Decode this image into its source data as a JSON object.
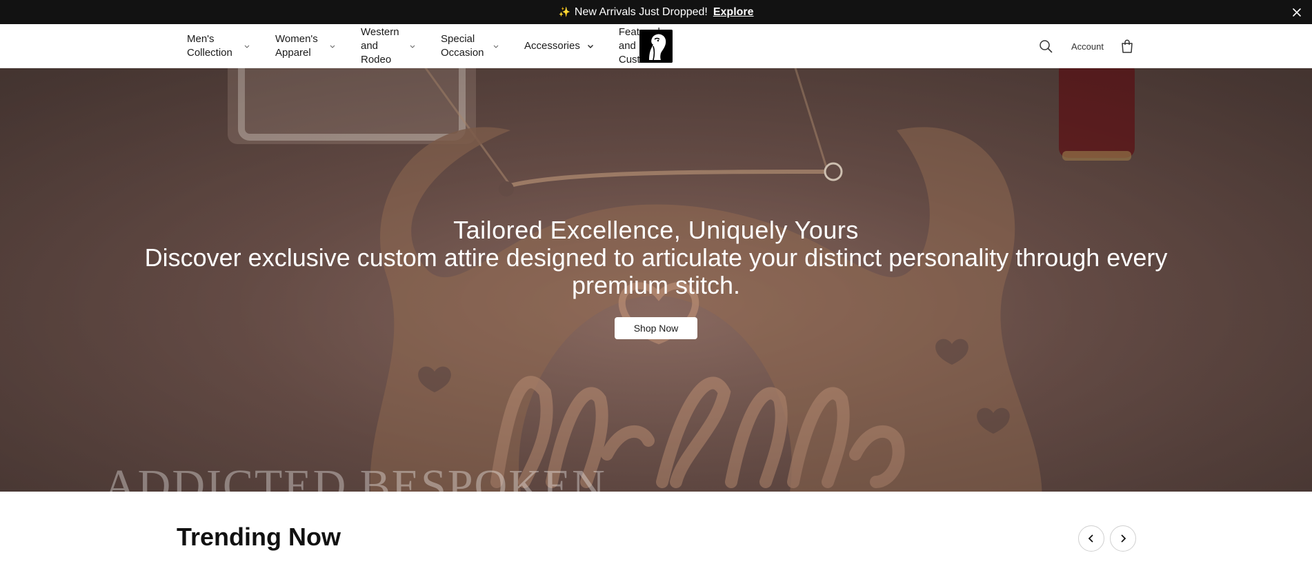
{
  "announcement": {
    "icon": "sparkles-icon",
    "text": "New Arrivals Just Dropped!",
    "link": "Explore"
  },
  "nav": {
    "items": [
      {
        "label": "Men's Collection",
        "icon": "chevron-down-icon"
      },
      {
        "label": "Women's Apparel",
        "icon": "chevron-down-icon"
      },
      {
        "label": "Western and Rodeo",
        "icon": "chevron-down-icon"
      },
      {
        "label": "Special Occasion",
        "icon": "chevron-down-icon"
      },
      {
        "label": "Accessories",
        "icon": "chevron-down-icon"
      },
      {
        "label": "Featured and Custom",
        "icon": "chevron-down-icon"
      }
    ]
  },
  "header": {
    "account": "Account",
    "search_icon": "search-icon",
    "bag_icon": "shopping-bag-icon",
    "logo_icon": "horse-head-logo"
  },
  "hero": {
    "title": "Tailored Excellence, Uniquely Yours",
    "subtitle": "Discover exclusive custom attire designed to articulate your distinct personality through every premium stitch.",
    "button": "Shop Now",
    "watermark": "ADDICTED BESPOKEN",
    "overlay_color": "#6f544d"
  },
  "trending": {
    "title": "Trending Now",
    "prev_icon": "chevron-left-icon",
    "next_icon": "chevron-right-icon"
  }
}
